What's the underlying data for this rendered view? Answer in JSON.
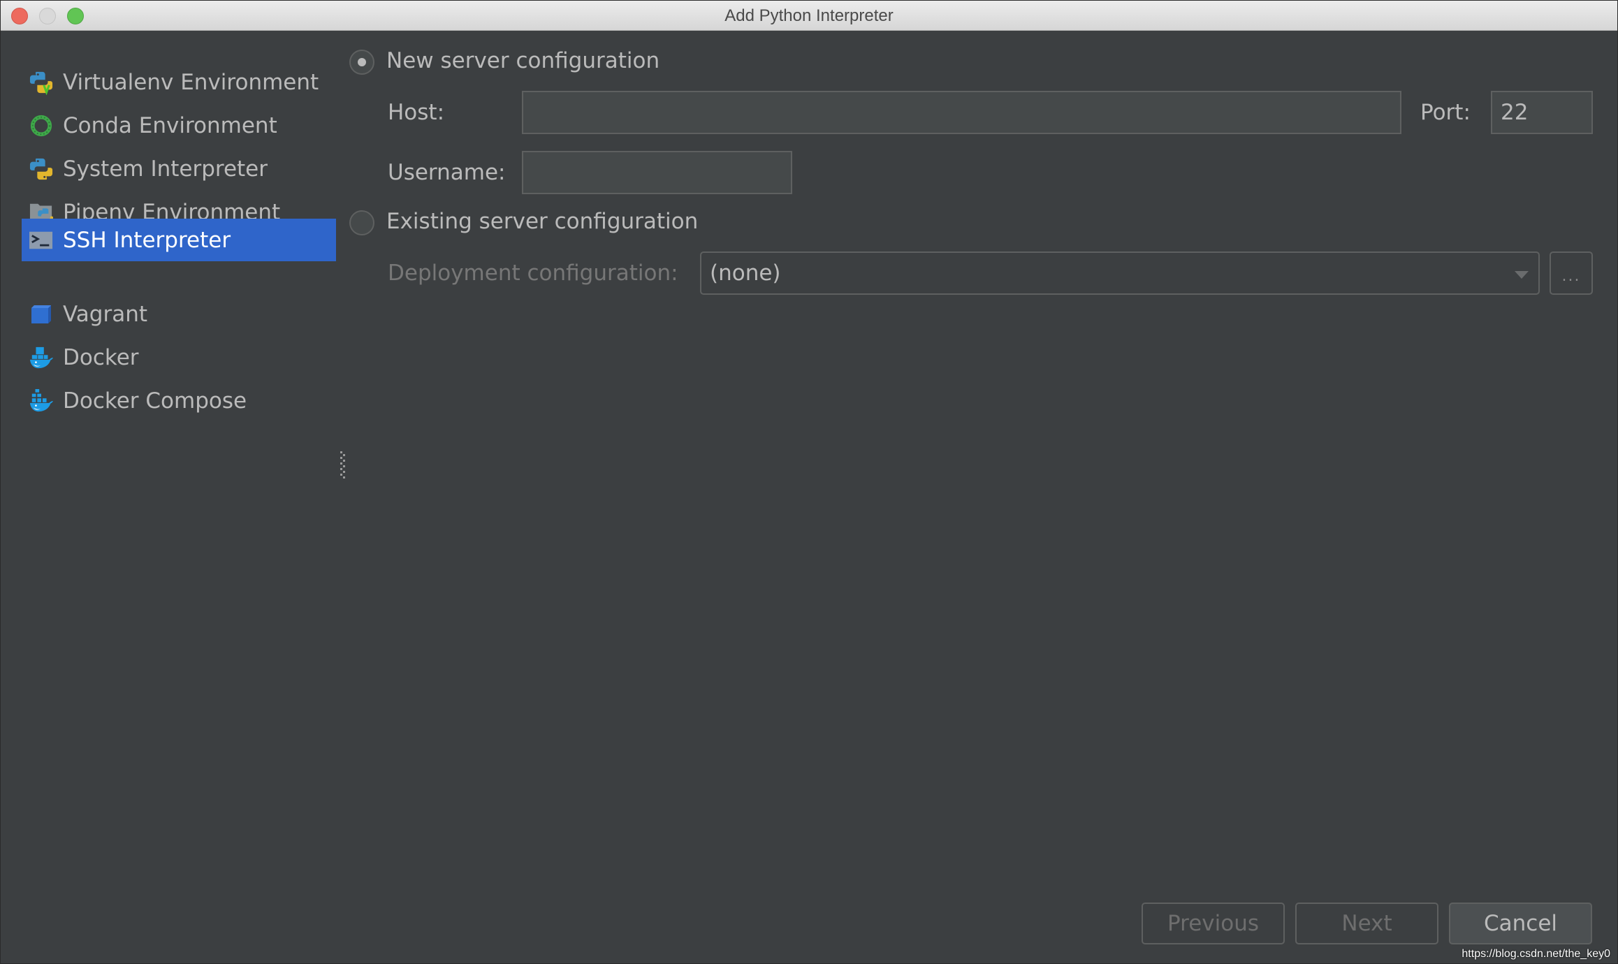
{
  "window": {
    "title": "Add Python Interpreter"
  },
  "sidebar": {
    "items": [
      {
        "label": "Virtualenv Environment",
        "icon": "python-virtualenv-icon",
        "selected": false
      },
      {
        "label": "Conda Environment",
        "icon": "conda-ring-icon",
        "selected": false
      },
      {
        "label": "System Interpreter",
        "icon": "python-icon",
        "selected": false
      },
      {
        "label": "Pipenv Environment",
        "icon": "pipenv-folder-python-icon",
        "selected": false
      },
      {
        "label": "SSH Interpreter",
        "icon": "terminal-prompt-icon",
        "selected": true
      },
      {
        "label": "Vagrant",
        "icon": "vagrant-cube-icon",
        "selected": false
      },
      {
        "label": "Docker",
        "icon": "docker-whale-icon",
        "selected": false
      },
      {
        "label": "Docker Compose",
        "icon": "docker-compose-whale-icon",
        "selected": false
      }
    ],
    "selected_color": "#2F65CA"
  },
  "main": {
    "new_server": {
      "label": "New server configuration",
      "checked": true,
      "host_label": "Host:",
      "host_value": "",
      "port_label": "Port:",
      "port_value": "22",
      "username_label": "Username:",
      "username_value": ""
    },
    "existing_server": {
      "label": "Existing server configuration",
      "checked": false,
      "deployment_label": "Deployment configuration:",
      "deployment_value": "(none)",
      "browse_label": "..."
    }
  },
  "footer": {
    "previous_label": "Previous",
    "next_label": "Next",
    "cancel_label": "Cancel"
  },
  "watermark": "https://blog.csdn.net/the_key0"
}
